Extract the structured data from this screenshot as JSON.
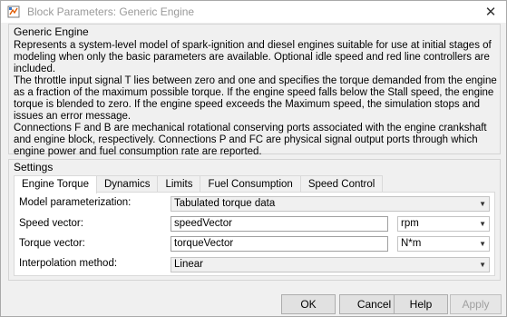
{
  "window": {
    "title": "Block Parameters: Generic Engine"
  },
  "description": {
    "group_title": "Generic Engine",
    "paragraphs": [
      "Represents a system-level model of spark-ignition and diesel engines suitable for use at initial stages of modeling when only the basic parameters are available. Optional idle speed and red line controllers are included.",
      "The throttle input signal T lies between zero and one and specifies the torque demanded from the engine as a fraction of the maximum possible torque. If the engine speed falls below the Stall speed, the engine torque is blended to zero. If the engine speed exceeds the Maximum speed, the simulation stops and issues an error message.",
      "Connections F and B are mechanical rotational conserving ports associated with the engine crankshaft and engine block, respectively. Connections P and FC are physical signal output ports through which engine power and fuel consumption rate are reported."
    ]
  },
  "settings": {
    "group_title": "Settings",
    "tabs": [
      {
        "label": "Engine Torque",
        "active": true
      },
      {
        "label": "Dynamics",
        "active": false
      },
      {
        "label": "Limits",
        "active": false
      },
      {
        "label": "Fuel Consumption",
        "active": false
      },
      {
        "label": "Speed Control",
        "active": false
      }
    ],
    "rows": {
      "model_param": {
        "label": "Model parameterization:",
        "value": "Tabulated torque data"
      },
      "speed_vector": {
        "label": "Speed vector:",
        "value": "speedVector",
        "unit": "rpm"
      },
      "torque_vector": {
        "label": "Torque vector:",
        "value": "torqueVector",
        "unit": "N*m"
      },
      "interp": {
        "label": "Interpolation method:",
        "value": "Linear"
      }
    }
  },
  "buttons": {
    "ok": "OK",
    "cancel": "Cancel",
    "help": "Help",
    "apply": "Apply"
  },
  "icons": {
    "app": "simulink-block-icon",
    "close": "close-icon",
    "dropdown": "chevron-down-icon"
  }
}
